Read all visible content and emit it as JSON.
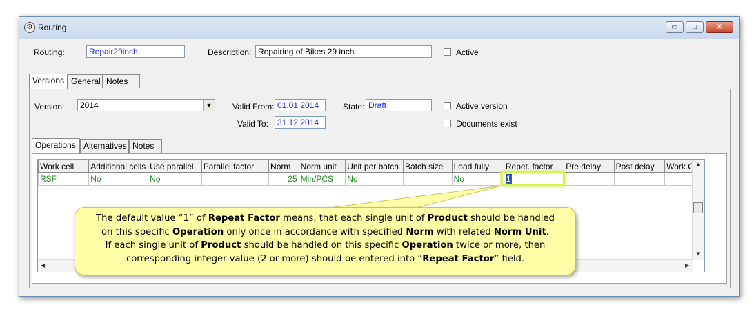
{
  "window": {
    "title": "Routing",
    "controls": {
      "minimize": "▭",
      "maximize": "□",
      "close": "✕"
    }
  },
  "header": {
    "routing_label": "Routing:",
    "routing_value": "Repair29inch",
    "description_label": "Description:",
    "description_value": "Repairing of Bikes 29 inch",
    "active_label": "Active"
  },
  "main_tabs": [
    "Versions",
    "General",
    "Notes"
  ],
  "version": {
    "version_label": "Version:",
    "version_value": "2014",
    "valid_from_label": "Valid From:",
    "valid_from_value": "01.01.2014",
    "valid_to_label": "Valid To:",
    "valid_to_value": "31.12.2014",
    "state_label": "State:",
    "state_value": "Draft",
    "active_version_label": "Active version",
    "documents_exist_label": "Documents exist"
  },
  "sub_tabs": [
    "Operations",
    "Alternatives",
    "Notes"
  ],
  "grid": {
    "columns": [
      "Work cell",
      "Additional cells",
      "Use parallel",
      "Parallel factor",
      "Norm",
      "Norm unit",
      "Unit per batch",
      "Batch size",
      "Load fully",
      "Repet. factor",
      "Pre delay",
      "Post delay",
      "Work Cell"
    ],
    "rows": [
      [
        "RSF",
        "No",
        "No",
        "",
        "25",
        "Min/PCS",
        "No",
        "",
        "No",
        "1",
        "",
        "",
        ""
      ]
    ]
  },
  "callout": {
    "line1_a": "The default value “1” of ",
    "line1_b": "Repeat Factor",
    "line1_c": " means, that each single unit of ",
    "line1_d": "Product",
    "line1_e": " should be handled",
    "line2_a": "on this specific ",
    "line2_b": "Operation",
    "line2_c": " only once in accordance with specified ",
    "line2_d": "Norm",
    "line2_e": " with related ",
    "line2_f": "Norm Unit",
    "line2_g": ".",
    "line3_a": "If each single unit of ",
    "line3_b": "Product",
    "line3_c": " should be handled on this specific ",
    "line3_d": "Operation",
    "line3_e": " twice or more, then",
    "line4_a": "corresponding integer value (2 or more) should be entered into “",
    "line4_b": "Repeat Factor",
    "line4_c": "” field."
  },
  "colors": {
    "highlight": "#d6f54a",
    "callout_bg": "#ffffa8",
    "grid_text": "#1a8a1a",
    "field_text": "#1b2bd6"
  }
}
